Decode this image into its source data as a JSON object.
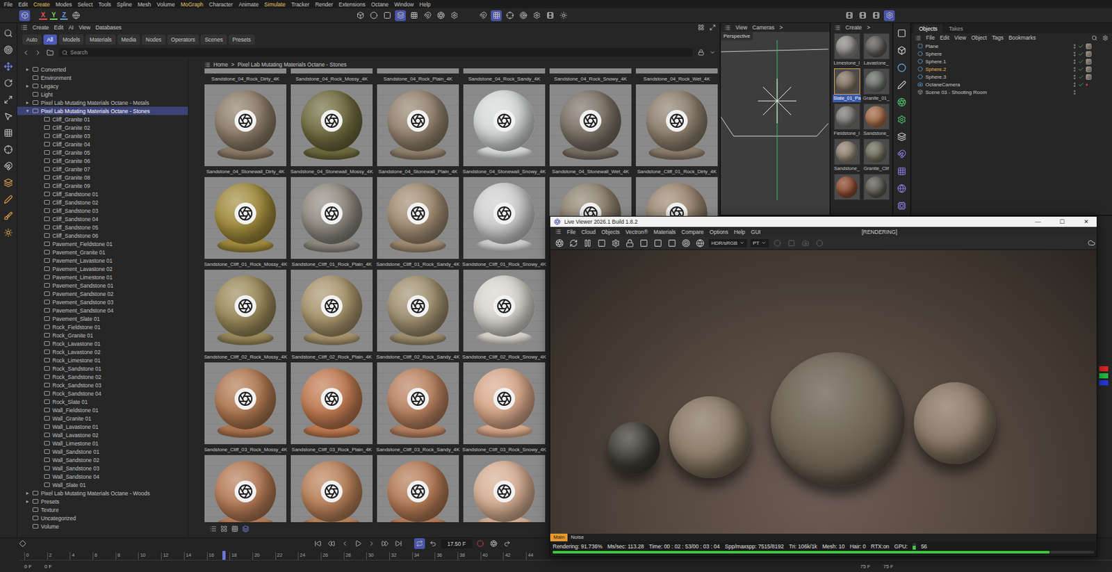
{
  "menu": [
    {
      "label": "File",
      "highlight": false
    },
    {
      "label": "Edit",
      "highlight": false
    },
    {
      "label": "Create",
      "highlight": true
    },
    {
      "label": "Modes",
      "highlight": false
    },
    {
      "label": "Select",
      "highlight": false
    },
    {
      "label": "Tools",
      "highlight": false
    },
    {
      "label": "Spline",
      "highlight": false
    },
    {
      "label": "Mesh",
      "highlight": false
    },
    {
      "label": "Volume",
      "highlight": false
    },
    {
      "label": "MoGraph",
      "highlight": true
    },
    {
      "label": "Character",
      "highlight": false
    },
    {
      "label": "Animate",
      "highlight": false
    },
    {
      "label": "Simulate",
      "highlight": true
    },
    {
      "label": "Tracker",
      "highlight": false
    },
    {
      "label": "Render",
      "highlight": false
    },
    {
      "label": "Extensions",
      "highlight": false
    },
    {
      "label": "Octane",
      "highlight": false
    },
    {
      "label": "Window",
      "highlight": false
    },
    {
      "label": "Help",
      "highlight": false
    }
  ],
  "toolbar": {
    "axes": [
      {
        "label": "X",
        "color": "#e25555"
      },
      {
        "label": "Y",
        "color": "#7fcf5a"
      },
      {
        "label": "Z",
        "color": "#6b9be8"
      }
    ]
  },
  "asset_browser": {
    "menu": [
      "Create",
      "Edit",
      "AI",
      "View",
      "Databases"
    ],
    "tabs": [
      {
        "label": "Auto",
        "selected": false
      },
      {
        "label": "All",
        "selected": true
      },
      {
        "label": "Models",
        "selected": false
      },
      {
        "label": "Materials",
        "selected": false
      },
      {
        "label": "Media",
        "selected": false
      },
      {
        "label": "Nodes",
        "selected": false
      },
      {
        "label": "Operators",
        "selected": false
      },
      {
        "label": "Scenes",
        "selected": false
      },
      {
        "label": "Presets",
        "selected": false
      }
    ],
    "search": {
      "placeholder": "Search"
    },
    "breadcrumb": [
      "Home",
      ">",
      "Pixel Lab Mutating Materials Octane - Stones"
    ],
    "tree": [
      {
        "label": "Converted",
        "depth": 0,
        "arrow": "▸",
        "selected": false
      },
      {
        "label": "Environment",
        "depth": 0,
        "selected": false
      },
      {
        "label": "Legacy",
        "depth": 0,
        "arrow": "▸",
        "selected": false
      },
      {
        "label": "Light",
        "depth": 0,
        "selected": false
      },
      {
        "label": "Pixel Lab Mutating Materials Octane - Metals",
        "depth": 0,
        "arrow": "▸",
        "selected": false
      },
      {
        "label": "Pixel Lab Mutating Materials Octane - Stones",
        "depth": 0,
        "arrow": "▾",
        "selected": true
      },
      {
        "label": "Cliff_Granite 01",
        "depth": 1,
        "selected": false
      },
      {
        "label": "Cliff_Granite 02",
        "depth": 1,
        "selected": false
      },
      {
        "label": "Cliff_Granite 03",
        "depth": 1,
        "selected": false
      },
      {
        "label": "Cliff_Granite 04",
        "depth": 1,
        "selected": false
      },
      {
        "label": "Cliff_Granite 05",
        "depth": 1,
        "selected": false
      },
      {
        "label": "Cliff_Granite 06",
        "depth": 1,
        "selected": false
      },
      {
        "label": "Cliff_Granite 07",
        "depth": 1,
        "selected": false
      },
      {
        "label": "Cliff_Granite 08",
        "depth": 1,
        "selected": false
      },
      {
        "label": "Cliff_Granite 09",
        "depth": 1,
        "selected": false
      },
      {
        "label": "Cliff_Sandstone 01",
        "depth": 1,
        "selected": false
      },
      {
        "label": "Cliff_Sandstone 02",
        "depth": 1,
        "selected": false
      },
      {
        "label": "Cliff_Sandstone 03",
        "depth": 1,
        "selected": false
      },
      {
        "label": "Cliff_Sandstone 04",
        "depth": 1,
        "selected": false
      },
      {
        "label": "Cliff_Sandstone 05",
        "depth": 1,
        "selected": false
      },
      {
        "label": "Cliff_Sandstone 06",
        "depth": 1,
        "selected": false
      },
      {
        "label": "Pavement_Fieldstone 01",
        "depth": 1,
        "selected": false
      },
      {
        "label": "Pavement_Granite 01",
        "depth": 1,
        "selected": false
      },
      {
        "label": "Pavement_Lavastone 01",
        "depth": 1,
        "selected": false
      },
      {
        "label": "Pavement_Lavastone 02",
        "depth": 1,
        "selected": false
      },
      {
        "label": "Pavement_Limestone 01",
        "depth": 1,
        "selected": false
      },
      {
        "label": "Pavement_Sandstone 01",
        "depth": 1,
        "selected": false
      },
      {
        "label": "Pavement_Sandstone 02",
        "depth": 1,
        "selected": false
      },
      {
        "label": "Pavement_Sandstone 03",
        "depth": 1,
        "selected": false
      },
      {
        "label": "Pavement_Sandstone 04",
        "depth": 1,
        "selected": false
      },
      {
        "label": "Pavement_Slate 01",
        "depth": 1,
        "selected": false
      },
      {
        "label": "Rock_Fieldstone 01",
        "depth": 1,
        "selected": false
      },
      {
        "label": "Rock_Granite 01",
        "depth": 1,
        "selected": false
      },
      {
        "label": "Rock_Lavastone 01",
        "depth": 1,
        "selected": false
      },
      {
        "label": "Rock_Lavastone 02",
        "depth": 1,
        "selected": false
      },
      {
        "label": "Rock_Limestone 01",
        "depth": 1,
        "selected": false
      },
      {
        "label": "Rock_Sandstone 01",
        "depth": 1,
        "selected": false
      },
      {
        "label": "Rock_Sandstone 02",
        "depth": 1,
        "selected": false
      },
      {
        "label": "Rock_Sandstone 03",
        "depth": 1,
        "selected": false
      },
      {
        "label": "Rock_Sandstone 04",
        "depth": 1,
        "selected": false
      },
      {
        "label": "Rock_Slate 01",
        "depth": 1,
        "selected": false
      },
      {
        "label": "Wall_Fieldstone 01",
        "depth": 1,
        "selected": false
      },
      {
        "label": "Wall_Granite 01",
        "depth": 1,
        "selected": false
      },
      {
        "label": "Wall_Lavastone 01",
        "depth": 1,
        "selected": false
      },
      {
        "label": "Wall_Lavastone 02",
        "depth": 1,
        "selected": false
      },
      {
        "label": "Wall_Limestone 01",
        "depth": 1,
        "selected": false
      },
      {
        "label": "Wall_Sandstone 01",
        "depth": 1,
        "selected": false
      },
      {
        "label": "Wall_Sandstone 02",
        "depth": 1,
        "selected": false
      },
      {
        "label": "Wall_Sandstone 03",
        "depth": 1,
        "selected": false
      },
      {
        "label": "Wall_Sandstone 04",
        "depth": 1,
        "selected": false
      },
      {
        "label": "Wall_Slate 01",
        "depth": 1,
        "selected": false
      },
      {
        "label": "Pixel Lab Mutating Materials Octane - Woods",
        "depth": 0,
        "arrow": "▸",
        "selected": false
      },
      {
        "label": "Presets",
        "depth": 0,
        "arrow": "▸",
        "selected": false
      },
      {
        "label": "Texture",
        "depth": 0,
        "selected": false
      },
      {
        "label": "Uncategorized",
        "depth": 0,
        "selected": false
      },
      {
        "label": "Volume",
        "depth": 0,
        "selected": false
      }
    ],
    "grid_rows": [
      [
        {
          "label": "Sandstone_04_Rock_Dirty_4K",
          "color": "#8c7c68"
        },
        {
          "label": "Sandstone_04_Rock_Mossy_4K",
          "color": "#77704a"
        },
        {
          "label": "Sandstone_04_Rock_Plain_4K",
          "color": "#8f8170"
        },
        {
          "label": "Sandstone_04_Rock_Sandy_4K",
          "color": "#9a8a72"
        },
        {
          "label": "Sandstone_04_Rock_Snowy_4K",
          "color": "#cfd2d2"
        },
        {
          "label": "Sandstone_04_Rock_Wet_4K",
          "color": "#7d7468"
        }
      ],
      [
        {
          "label": "Sandstone_04_Stonewall_Dirty_4K",
          "color": "#8c7c68"
        },
        {
          "label": "Sandstone_04_Stonewall_Mossy_4K",
          "color": "#6f6a3e"
        },
        {
          "label": "Sandstone_04_Stonewall_Plain_4K",
          "color": "#93826e"
        },
        {
          "label": "Sandstone_04_Stonewall_Snowy_4K",
          "color": "#d5d8d8"
        },
        {
          "label": "Sandstone_04_Stonewall_Wet_4K",
          "color": "#7a7064"
        },
        {
          "label": "Sandstone_Cliff_01_Rock_Dirty_4K",
          "color": "#8d7e6d"
        }
      ],
      [
        {
          "label": "Sandstone_Cliff_01_Rock_Mossy_4K",
          "color": "#a08a3c"
        },
        {
          "label": "Sandstone_Cliff_01_Rock_Plain_4K",
          "color": "#8f8a80"
        },
        {
          "label": "Sandstone_Cliff_01_Rock_Sandy_4K",
          "color": "#a08c72"
        },
        {
          "label": "Sandstone_Cliff_01_Rock_Snowy_4K",
          "color": "#cfcfcf"
        },
        {
          "color": "#8e8270"
        },
        {
          "color": "#9a8670"
        }
      ],
      [
        {
          "label": "Sandstone_Cliff_02_Rock_Mossy_4K",
          "color": "#9a8a5a"
        },
        {
          "label": "Sandstone_Cliff_02_Rock_Plain_4K",
          "color": "#a8946c"
        },
        {
          "label": "Sandstone_Cliff_02_Rock_Sandy_4K",
          "color": "#a09070"
        },
        {
          "label": "Sandstone_Cliff_02_Rock_Snowy_4K",
          "color": "#d8d4cc"
        }
      ],
      [
        {
          "label": "Sandstone_Cliff_03_Rock_Mossy_4K",
          "color": "#b07850"
        },
        {
          "label": "Sandstone_Cliff_03_Rock_Plain_4K",
          "color": "#c07a50"
        },
        {
          "label": "Sandstone_Cliff_03_Rock_Sandy_4K",
          "color": "#b98260"
        },
        {
          "label": "Sandstone_Cliff_03_Rock_Snowy_4K",
          "color": "#d8a88a"
        }
      ],
      [
        {
          "color": "#b47a55"
        },
        {
          "color": "#b88058"
        },
        {
          "color": "#b47a55"
        },
        {
          "color": "#d6ae92"
        }
      ]
    ]
  },
  "viewport": {
    "menu": [
      "View",
      "Cameras",
      ">"
    ],
    "camera": "Perspective"
  },
  "material_manager": {
    "menu": [
      "Create",
      ">"
    ],
    "materials": [
      {
        "label": "Limestone_I",
        "selected": false,
        "color": "#8c8a86"
      },
      {
        "label": "Lavastone_",
        "selected": false,
        "color": "#5a5856"
      },
      {
        "label": "Slate_01_Pa",
        "selected": true,
        "color": "#807060"
      },
      {
        "label": "Granite_01_",
        "selected": false,
        "color": "#666a64"
      },
      {
        "label": "Fieldstone_I",
        "selected": false,
        "color": "#7c7874"
      },
      {
        "label": "Sandstone_",
        "selected": false,
        "color": "#a06a48"
      },
      {
        "label": "Sandstone_",
        "selected": false,
        "color": "#8e8070"
      },
      {
        "label": "Granite_Clif",
        "selected": false,
        "color": "#6c6a5a"
      },
      {
        "color": "#8a4a30",
        "selected": false
      },
      {
        "color": "#5a5a50",
        "selected": false
      }
    ]
  },
  "objects": {
    "tabs": [
      {
        "label": "Objects",
        "selected": true
      },
      {
        "label": "Takes",
        "selected": false
      }
    ],
    "menu": [
      "File",
      "Edit",
      "View",
      "Object",
      "Tags",
      "Bookmarks"
    ],
    "rows": [
      {
        "name": "Plane",
        "kind": "plane",
        "selected": false
      },
      {
        "name": "Sphere",
        "kind": "sphere",
        "selected": false
      },
      {
        "name": "Sphere.1",
        "kind": "sphere",
        "selected": false
      },
      {
        "name": "Sphere.2",
        "kind": "sphere",
        "selected": true
      },
      {
        "name": "Sphere.3",
        "kind": "sphere",
        "selected": false
      },
      {
        "name": "OctaneCamera",
        "kind": "camera",
        "selected": false
      },
      {
        "name": "Scene 03 - Shooting Room",
        "kind": "scene",
        "selected": false
      }
    ]
  },
  "timeline": {
    "ruler": [
      "0",
      "2",
      "4",
      "6",
      "8",
      "10",
      "12",
      "14",
      "16",
      "18",
      "20",
      "22",
      "24",
      "26",
      "28",
      "30",
      "32",
      "34",
      "36",
      "38",
      "40",
      "42",
      "44"
    ],
    "frame_field": "17.50 F",
    "playhead_frame": 17.5,
    "range_start": [
      "0 F",
      "0 F"
    ],
    "range_end": [
      "75 F",
      "75 F"
    ]
  },
  "live_viewer": {
    "title": "Live Viewer 2026.1 Build 1.8.2",
    "window_buttons": [
      "—",
      "☐",
      "✕"
    ],
    "menu": [
      "File",
      "Cloud",
      "Objects",
      "Vectron®",
      "Materials",
      "Compare",
      "Options",
      "Help",
      "GUI"
    ],
    "state": "[RENDERING]",
    "dropdowns": [
      "HDR/sRGB",
      "PT"
    ],
    "tabs": [
      {
        "label": "Main",
        "selected": true
      },
      {
        "label": "Noise",
        "selected": false
      }
    ],
    "status": [
      {
        "label": "Rendering:",
        "value": "91.736%"
      },
      {
        "label": "Ms/sec:",
        "value": "113.28"
      },
      {
        "label": "Time:",
        "value": "00 : 02 : 53/00 : 03 : 04"
      },
      {
        "label": "Spp/maxspp:",
        "value": "7515/8192"
      },
      {
        "label": "Tri:",
        "value": "106k/1k"
      },
      {
        "label": "Mesh:",
        "value": "10"
      },
      {
        "label": "Hair:",
        "value": "0"
      },
      {
        "label": "RTX:on",
        "value": ""
      }
    ],
    "gpu": {
      "label": "GPU:",
      "value": "56",
      "level": 0.56
    },
    "progress": 0.917
  }
}
